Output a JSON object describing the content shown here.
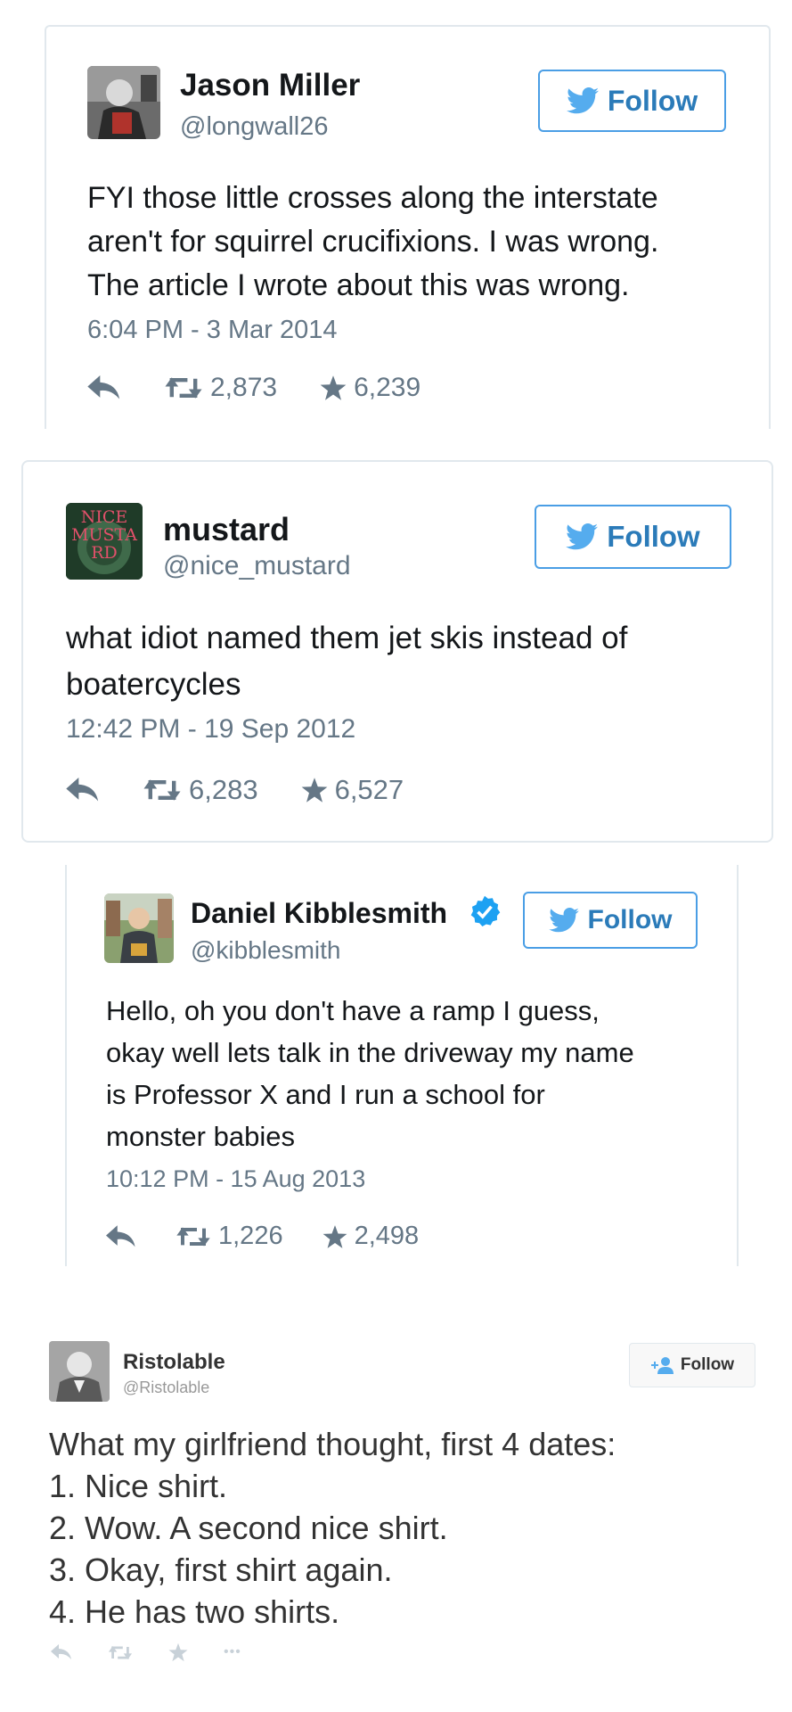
{
  "colors": {
    "accent": "#55acee",
    "follow_text": "#2b7bb9",
    "muted": "#657786",
    "border": "#e1e8ed",
    "verified": "#1da1f2"
  },
  "tweets": [
    {
      "name": "Jason Miller",
      "handle": "@longwall26",
      "follow_label": "Follow",
      "text": "FYI those little crosses along the interstate\naren't for squirrel crucifixions. I was wrong.\nThe article I wrote about this was wrong.",
      "time": "6:04 PM - 3 Mar 2014",
      "retweets": "2,873",
      "likes": "6,239",
      "icons": [
        "reply-icon",
        "retweet-icon",
        "star-icon",
        "twitter-bird-icon"
      ]
    },
    {
      "name": "mustard",
      "handle": "@nice_mustard",
      "avatar_text": "NICE MUSTARD",
      "follow_label": "Follow",
      "text": "what idiot named them jet skis instead of\nboatercycles",
      "time": "12:42 PM - 19 Sep 2012",
      "retweets": "6,283",
      "likes": "6,527",
      "icons": [
        "reply-icon",
        "retweet-icon",
        "star-icon",
        "twitter-bird-icon"
      ]
    },
    {
      "name": "Daniel Kibblesmith",
      "handle": "@kibblesmith",
      "verified": true,
      "follow_label": "Follow",
      "text": "Hello, oh you don't have a ramp I guess,\nokay well lets talk in the driveway my name\nis Professor X and I run a school for\nmonster babies",
      "time": "10:12 PM - 15 Aug 2013",
      "retweets": "1,226",
      "likes": "2,498",
      "icons": [
        "reply-icon",
        "retweet-icon",
        "star-icon",
        "verified-badge-icon",
        "twitter-bird-icon"
      ]
    },
    {
      "name": "Ristolable",
      "handle": "@Ristolable",
      "follow_label": "Follow",
      "text": "What my girlfriend thought, first 4 dates:\n1. Nice shirt.\n2. Wow. A second nice shirt.\n3. Okay, first shirt again.\n4. He has two shirts.",
      "more_label": "•••",
      "icons": [
        "reply-icon",
        "retweet-icon",
        "star-icon",
        "more-icon",
        "add-user-icon"
      ]
    }
  ]
}
